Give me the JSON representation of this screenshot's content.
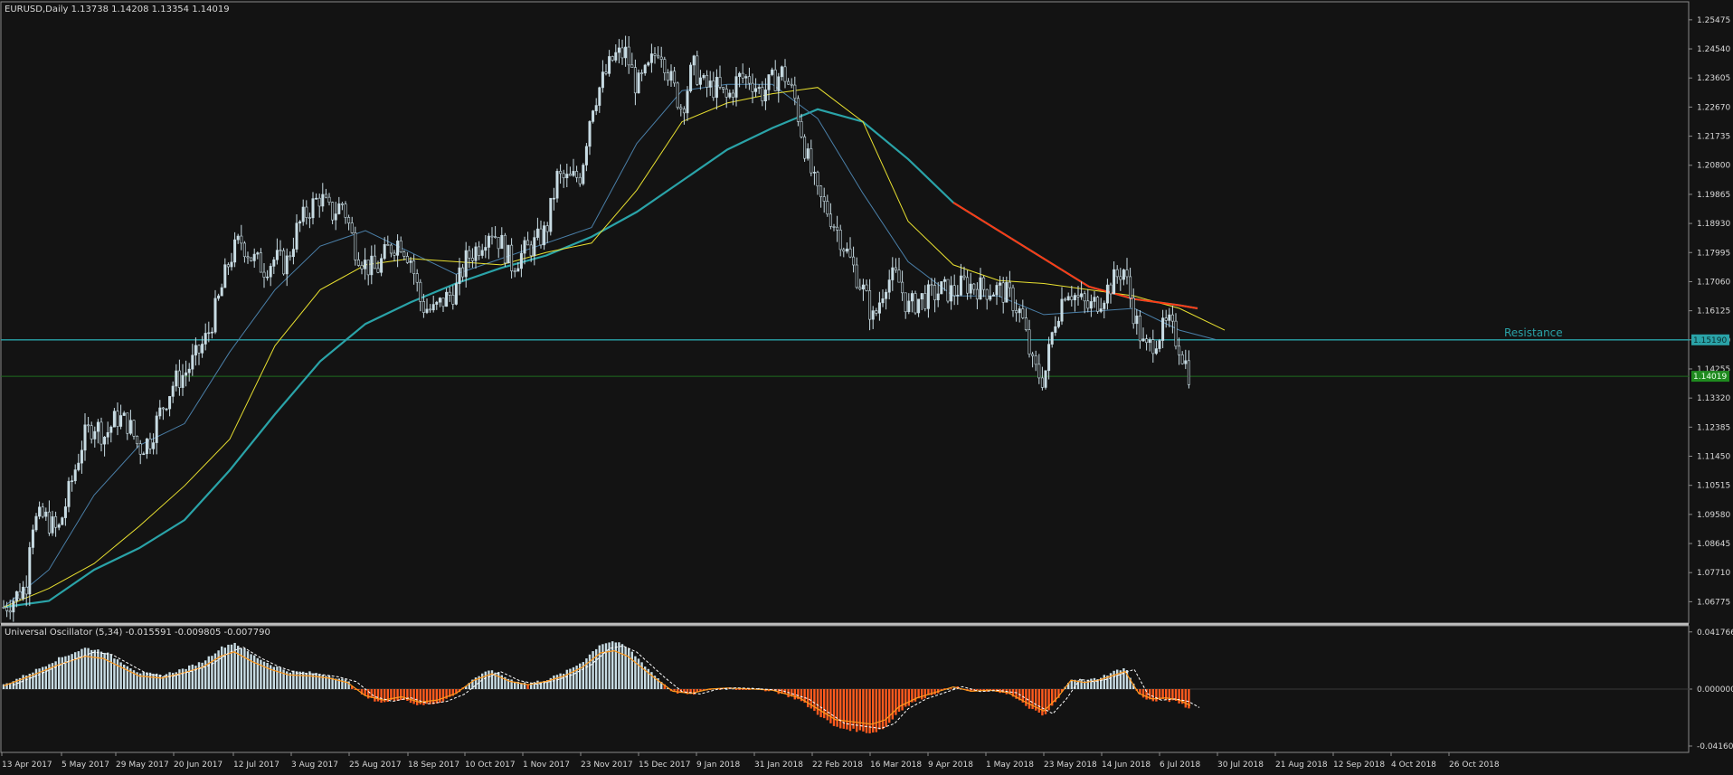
{
  "window": {
    "symbol_header": "EURUSD,Daily  1.13738 1.14208 1.13354 1.14019",
    "indicator_header": "Universal Oscillator (5,34) -0.015591 -0.009805 -0.007790"
  },
  "colors": {
    "background": "#131313",
    "bull_candle": "#c8dce4",
    "bear_candle": "#c8dce4",
    "ma_slow": "#2aa3a8",
    "ma_fast": "#4a7fa8",
    "ma_yellow": "#e8e030",
    "ma_red": "#ff3a14",
    "ma_green": "#22d838",
    "resistance": "#2aa3a8",
    "price_line": "#1f6b1f",
    "hist_up": "#c8dce4",
    "hist_down": "#ff5a1e"
  },
  "chart_data": {
    "type": "candlestick",
    "title": "EURUSD,Daily",
    "ohlc_header": "1.13738 1.14208 1.13354 1.14019",
    "ylim": [
      1.0635,
      1.2582
    ],
    "y_ticks": [
      "1.25475",
      "1.24540",
      "1.23605",
      "1.22670",
      "1.21735",
      "1.20800",
      "1.19865",
      "1.18930",
      "1.17995",
      "1.17060",
      "1.16125",
      "1.15190",
      "1.14255",
      "1.13320",
      "1.12385",
      "1.11450",
      "1.10515",
      "1.09580",
      "1.08645",
      "1.07710",
      "1.06775"
    ],
    "x_ticks": [
      "13 Apr 2017",
      "5 May 2017",
      "29 May 2017",
      "20 Jun 2017",
      "12 Jul 2017",
      "3 Aug 2017",
      "25 Aug 2017",
      "18 Sep 2017",
      "10 Oct 2017",
      "1 Nov 2017",
      "23 Nov 2017",
      "15 Dec 2017",
      "9 Jan 2018",
      "31 Jan 2018",
      "22 Feb 2018",
      "16 Mar 2018",
      "9 Apr 2018",
      "1 May 2018",
      "23 May 2018",
      "14 Jun 2018",
      "6 Jul 2018",
      "30 Jul 2018",
      "21 Aug 2018",
      "12 Sep 2018",
      "4 Oct 2018",
      "26 Oct 2018"
    ],
    "price_path": [
      [
        0,
        1.066
      ],
      [
        12,
        1.069
      ],
      [
        25,
        1.073
      ],
      [
        30,
        1.093
      ],
      [
        45,
        1.095
      ],
      [
        60,
        1.09
      ],
      [
        75,
        1.106
      ],
      [
        88,
        1.12
      ],
      [
        100,
        1.125
      ],
      [
        112,
        1.121
      ],
      [
        125,
        1.127
      ],
      [
        138,
        1.125
      ],
      [
        150,
        1.117
      ],
      [
        162,
        1.12
      ],
      [
        175,
        1.13
      ],
      [
        188,
        1.138
      ],
      [
        200,
        1.141
      ],
      [
        212,
        1.146
      ],
      [
        225,
        1.153
      ],
      [
        238,
        1.165
      ],
      [
        250,
        1.178
      ],
      [
        262,
        1.184
      ],
      [
        275,
        1.178
      ],
      [
        288,
        1.175
      ],
      [
        300,
        1.178
      ],
      [
        312,
        1.176
      ],
      [
        325,
        1.188
      ],
      [
        338,
        1.194
      ],
      [
        350,
        1.198
      ],
      [
        362,
        1.192
      ],
      [
        375,
        1.196
      ],
      [
        388,
        1.182
      ],
      [
        400,
        1.176
      ],
      [
        412,
        1.174
      ],
      [
        425,
        1.181
      ],
      [
        438,
        1.184
      ],
      [
        450,
        1.178
      ],
      [
        462,
        1.163
      ],
      [
        475,
        1.161
      ],
      [
        488,
        1.165
      ],
      [
        500,
        1.168
      ],
      [
        512,
        1.178
      ],
      [
        525,
        1.182
      ],
      [
        538,
        1.188
      ],
      [
        550,
        1.183
      ],
      [
        562,
        1.176
      ],
      [
        575,
        1.18
      ],
      [
        588,
        1.183
      ],
      [
        600,
        1.187
      ],
      [
        612,
        1.204
      ],
      [
        625,
        1.203
      ],
      [
        638,
        1.205
      ],
      [
        650,
        1.227
      ],
      [
        662,
        1.235
      ],
      [
        675,
        1.243
      ],
      [
        688,
        1.244
      ],
      [
        700,
        1.233
      ],
      [
        712,
        1.238
      ],
      [
        725,
        1.247
      ],
      [
        738,
        1.235
      ],
      [
        750,
        1.226
      ],
      [
        762,
        1.24
      ],
      [
        775,
        1.233
      ],
      [
        788,
        1.233
      ],
      [
        800,
        1.229
      ],
      [
        812,
        1.236
      ],
      [
        825,
        1.236
      ],
      [
        838,
        1.231
      ],
      [
        850,
        1.235
      ],
      [
        862,
        1.238
      ],
      [
        875,
        1.229
      ],
      [
        887,
        1.212
      ],
      [
        900,
        1.198
      ],
      [
        912,
        1.193
      ],
      [
        925,
        1.185
      ],
      [
        938,
        1.176
      ],
      [
        950,
        1.168
      ],
      [
        962,
        1.158
      ],
      [
        975,
        1.171
      ],
      [
        988,
        1.172
      ],
      [
        1000,
        1.162
      ],
      [
        1012,
        1.165
      ],
      [
        1025,
        1.166
      ],
      [
        1038,
        1.168
      ],
      [
        1050,
        1.167
      ],
      [
        1062,
        1.17
      ],
      [
        1075,
        1.169
      ],
      [
        1088,
        1.168
      ],
      [
        1100,
        1.168
      ],
      [
        1112,
        1.166
      ],
      [
        1125,
        1.16
      ],
      [
        1138,
        1.143
      ],
      [
        1150,
        1.139
      ],
      [
        1162,
        1.158
      ],
      [
        1175,
        1.169
      ],
      [
        1188,
        1.165
      ],
      [
        1200,
        1.162
      ],
      [
        1212,
        1.165
      ],
      [
        1225,
        1.17
      ],
      [
        1238,
        1.175
      ],
      [
        1250,
        1.16
      ],
      [
        1262,
        1.148
      ],
      [
        1275,
        1.153
      ],
      [
        1288,
        1.157
      ],
      [
        1300,
        1.15
      ],
      [
        1312,
        1.14
      ]
    ],
    "ma_slow": [
      [
        0,
        1.066
      ],
      [
        50,
        1.068
      ],
      [
        100,
        1.078
      ],
      [
        150,
        1.085
      ],
      [
        200,
        1.094
      ],
      [
        250,
        1.11
      ],
      [
        300,
        1.128
      ],
      [
        350,
        1.145
      ],
      [
        400,
        1.157
      ],
      [
        450,
        1.164
      ],
      [
        500,
        1.17
      ],
      [
        550,
        1.175
      ],
      [
        600,
        1.179
      ],
      [
        650,
        1.185
      ],
      [
        700,
        1.193
      ],
      [
        750,
        1.203
      ],
      [
        800,
        1.213
      ],
      [
        850,
        1.22
      ],
      [
        900,
        1.226
      ],
      [
        950,
        1.222
      ],
      [
        1000,
        1.21
      ],
      [
        1050,
        1.196
      ],
      [
        1100,
        1.187
      ],
      [
        1150,
        1.178
      ],
      [
        1200,
        1.169
      ],
      [
        1250,
        1.165
      ],
      [
        1300,
        1.163
      ],
      [
        1320,
        1.162
      ]
    ],
    "ma_fast": [
      [
        0,
        1.066
      ],
      [
        50,
        1.078
      ],
      [
        100,
        1.102
      ],
      [
        150,
        1.118
      ],
      [
        200,
        1.125
      ],
      [
        250,
        1.148
      ],
      [
        300,
        1.168
      ],
      [
        350,
        1.182
      ],
      [
        400,
        1.187
      ],
      [
        450,
        1.18
      ],
      [
        500,
        1.173
      ],
      [
        550,
        1.178
      ],
      [
        600,
        1.183
      ],
      [
        650,
        1.188
      ],
      [
        700,
        1.215
      ],
      [
        750,
        1.232
      ],
      [
        800,
        1.234
      ],
      [
        850,
        1.234
      ],
      [
        900,
        1.223
      ],
      [
        950,
        1.199
      ],
      [
        1000,
        1.177
      ],
      [
        1050,
        1.166
      ],
      [
        1100,
        1.166
      ],
      [
        1150,
        1.16
      ],
      [
        1200,
        1.161
      ],
      [
        1250,
        1.162
      ],
      [
        1300,
        1.155
      ],
      [
        1340,
        1.152
      ]
    ],
    "ma_yellow": [
      [
        0,
        1.066
      ],
      [
        50,
        1.072
      ],
      [
        100,
        1.08
      ],
      [
        150,
        1.092
      ],
      [
        200,
        1.105
      ],
      [
        250,
        1.12
      ],
      [
        300,
        1.15
      ],
      [
        350,
        1.168
      ],
      [
        400,
        1.176
      ],
      [
        450,
        1.178
      ],
      [
        500,
        1.177
      ],
      [
        550,
        1.176
      ],
      [
        600,
        1.18
      ],
      [
        650,
        1.183
      ],
      [
        700,
        1.2
      ],
      [
        750,
        1.222
      ],
      [
        800,
        1.228
      ],
      [
        850,
        1.231
      ],
      [
        900,
        1.233
      ],
      [
        950,
        1.222
      ],
      [
        1000,
        1.19
      ],
      [
        1050,
        1.176
      ],
      [
        1100,
        1.171
      ],
      [
        1150,
        1.17
      ],
      [
        1200,
        1.168
      ],
      [
        1250,
        1.166
      ],
      [
        1300,
        1.162
      ],
      [
        1350,
        1.155
      ]
    ],
    "signal_hist": [
      [
        0,
        0.003
      ],
      [
        30,
        0.012
      ],
      [
        60,
        0.022
      ],
      [
        90,
        0.03
      ],
      [
        110,
        0.028
      ],
      [
        130,
        0.02
      ],
      [
        150,
        0.012
      ],
      [
        175,
        0.01
      ],
      [
        200,
        0.015
      ],
      [
        220,
        0.02
      ],
      [
        240,
        0.03
      ],
      [
        255,
        0.034
      ],
      [
        275,
        0.025
      ],
      [
        295,
        0.018
      ],
      [
        315,
        0.013
      ],
      [
        340,
        0.012
      ],
      [
        360,
        0.01
      ],
      [
        380,
        0.006
      ],
      [
        400,
        -0.006
      ],
      [
        420,
        -0.01
      ],
      [
        440,
        -0.007
      ],
      [
        460,
        -0.012
      ],
      [
        480,
        -0.01
      ],
      [
        500,
        -0.004
      ],
      [
        520,
        0.008
      ],
      [
        540,
        0.014
      ],
      [
        560,
        0.007
      ],
      [
        580,
        0.004
      ],
      [
        600,
        0.007
      ],
      [
        620,
        0.012
      ],
      [
        640,
        0.02
      ],
      [
        660,
        0.033
      ],
      [
        675,
        0.035
      ],
      [
        690,
        0.03
      ],
      [
        705,
        0.02
      ],
      [
        720,
        0.01
      ],
      [
        740,
        -0.002
      ],
      [
        760,
        -0.004
      ],
      [
        780,
        0.0
      ],
      [
        800,
        0.001
      ],
      [
        830,
        0.0
      ],
      [
        850,
        -0.001
      ],
      [
        880,
        -0.008
      ],
      [
        900,
        -0.018
      ],
      [
        920,
        -0.028
      ],
      [
        940,
        -0.03
      ],
      [
        960,
        -0.032
      ],
      [
        975,
        -0.028
      ],
      [
        990,
        -0.016
      ],
      [
        1010,
        -0.008
      ],
      [
        1030,
        -0.003
      ],
      [
        1050,
        0.002
      ],
      [
        1070,
        -0.002
      ],
      [
        1090,
        -0.001
      ],
      [
        1110,
        -0.003
      ],
      [
        1130,
        -0.012
      ],
      [
        1150,
        -0.02
      ],
      [
        1165,
        -0.008
      ],
      [
        1180,
        0.008
      ],
      [
        1195,
        0.006
      ],
      [
        1210,
        0.008
      ],
      [
        1225,
        0.012
      ],
      [
        1240,
        0.016
      ],
      [
        1255,
        -0.004
      ],
      [
        1270,
        -0.009
      ],
      [
        1285,
        -0.008
      ],
      [
        1300,
        -0.01
      ],
      [
        1312,
        -0.015
      ]
    ],
    "osc_ticks": [
      "0.041766",
      "0.000000",
      "-0.041605"
    ],
    "osc_ylim": [
      -0.0436,
      0.0436
    ],
    "resistance_level": 1.1519,
    "resistance_label": "Resistance",
    "price_label_resistance": "1.15190",
    "price_label_current": "1.14019",
    "current_price": 1.14019
  }
}
